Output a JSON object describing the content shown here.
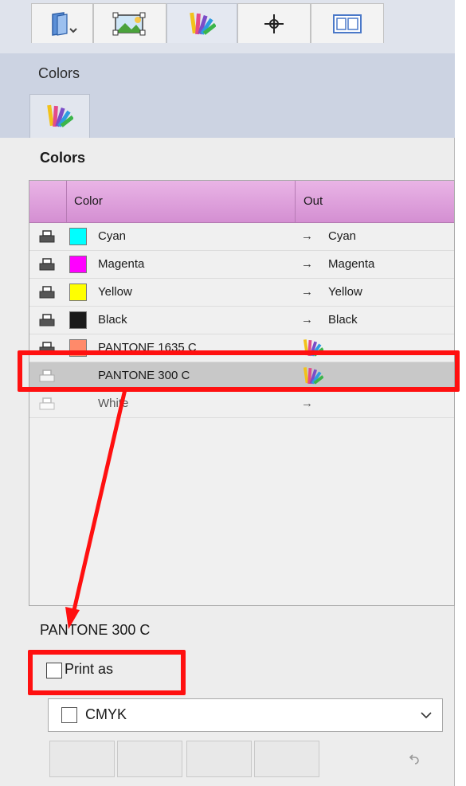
{
  "toolbar": {
    "tabs": [
      {
        "icon": "document-icon",
        "active": false
      },
      {
        "icon": "image-icon",
        "active": false
      },
      {
        "icon": "color-swatches-icon",
        "active": true
      },
      {
        "icon": "crosshair-icon",
        "active": false
      },
      {
        "icon": "layout-icon",
        "active": false
      }
    ]
  },
  "subheader": {
    "title": "Colors",
    "tab_icon": "color-swatches-icon"
  },
  "section": {
    "title": "Colors"
  },
  "table": {
    "headers": {
      "color": "Color",
      "out": "Out"
    },
    "rows": [
      {
        "name": "Cyan",
        "swatch": "#00ffff",
        "out": "Cyan",
        "out_arrow": "→",
        "selected": false
      },
      {
        "name": "Magenta",
        "swatch": "#ff00ff",
        "out": "Magenta",
        "out_arrow": "→",
        "selected": false
      },
      {
        "name": "Yellow",
        "swatch": "#ffff00",
        "out": "Yellow",
        "out_arrow": "→",
        "selected": false
      },
      {
        "name": "Black",
        "swatch": "#1a1a1a",
        "out": "Black",
        "out_arrow": "→",
        "selected": false
      },
      {
        "name": "PANTONE 1635 C",
        "swatch": "#ff8a6a",
        "out_icon": "color-swatches-icon",
        "selected": false
      },
      {
        "name": "PANTONE 300 C",
        "swatch": null,
        "out_icon": "color-swatches-icon",
        "selected": true
      },
      {
        "name": "White",
        "swatch": null,
        "out_arrow": "→",
        "selected": false
      }
    ]
  },
  "detail": {
    "selected_name": "PANTONE 300 C",
    "print_as_label": "Print as",
    "print_as_checked": false,
    "select_value": "CMYK",
    "select_checked": false
  },
  "colors": {
    "highlight": "#ff1010",
    "header": "#d9a0d7"
  }
}
